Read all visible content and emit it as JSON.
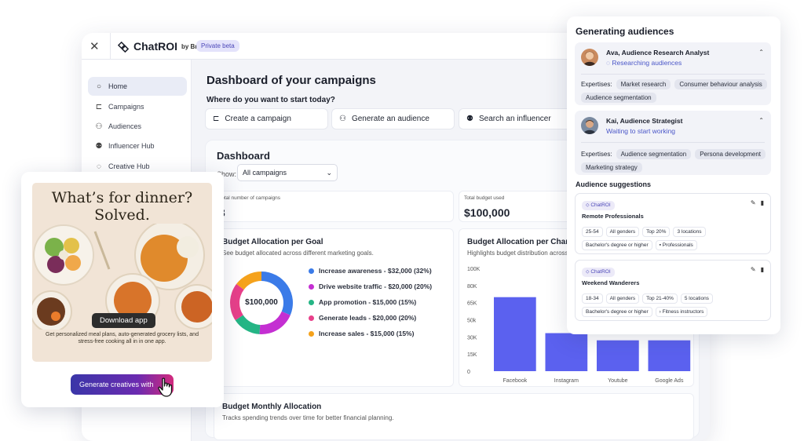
{
  "app": {
    "close_icon": "close-icon",
    "brand": "ChatROI",
    "brand_suffix": "by Bryj",
    "beta_badge": "Private beta"
  },
  "sidebar": {
    "items": [
      {
        "label": "Home",
        "icon": "home-icon"
      },
      {
        "label": "Campaigns",
        "icon": "megaphone-icon"
      },
      {
        "label": "Audiences",
        "icon": "users-icon"
      },
      {
        "label": "Influencer Hub",
        "icon": "influencer-icon"
      },
      {
        "label": "Creative Hub",
        "icon": "creative-icon"
      }
    ]
  },
  "main": {
    "title": "Dashboard of your campaigns",
    "subtitle": "Where do you want to start today?",
    "actions": [
      {
        "label": "Create a campaign",
        "icon": "megaphone-icon"
      },
      {
        "label": "Generate an audience",
        "icon": "users-icon"
      },
      {
        "label": "Search an influencer",
        "icon": "influencer-icon"
      }
    ]
  },
  "dashboard": {
    "title": "Dashboard",
    "show_label": "Show:",
    "filter_value": "All campaigns",
    "stats": [
      {
        "label": "Total number of campaigns",
        "value": "3"
      },
      {
        "label": "Total budget used",
        "value": "$100,000"
      }
    ],
    "goal_card": {
      "title": "Budget Allocation per Goal",
      "subtitle": "See budget allocated across different marketing goals.",
      "center_label": "$100,000"
    },
    "channel_card": {
      "title": "Budget Allocation per Channel",
      "subtitle": "Highlights budget distribution across channels."
    },
    "monthly_card": {
      "title": "Budget Monthly Allocation",
      "subtitle": "Tracks spending trends over time for better financial planning."
    }
  },
  "chart_data": [
    {
      "type": "pie",
      "title": "Budget Allocation per Goal",
      "categories": [
        "Increase awareness - $32,000 (32%)",
        "Drive website traffic - $20,000 (20%)",
        "App promotion - $15,000 (15%)",
        "Generate leads - $20,000 (20%)",
        "Increase sales - $15,000 (15%)"
      ],
      "values": [
        32,
        20,
        15,
        20,
        15
      ],
      "colors": [
        "#3b7be8",
        "#c42fd2",
        "#25b585",
        "#e8408a",
        "#f5a21c"
      ],
      "legend": "right"
    },
    {
      "type": "bar",
      "title": "Budget Allocation per Channel",
      "categories": [
        "Facebook",
        "Instagram",
        "Youtube",
        "Google Ads"
      ],
      "values": [
        72000,
        37000,
        30000,
        30000
      ],
      "yticks": [
        "100K",
        "80K",
        "65K",
        "50k",
        "30K",
        "15K",
        "0"
      ],
      "ylim": [
        0,
        100000
      ],
      "color": "#5b61ef",
      "grid": false
    }
  ],
  "promo": {
    "headline_1": "What’s for dinner?",
    "headline_2": "Solved.",
    "download_label": "Download app",
    "body": "Get personalized meal plans, auto-generated grocery lists, and stress-free cooking all in in one app.",
    "generate_label": "Generate creatives with",
    "cursor_icon": "hand-cursor-icon"
  },
  "panel": {
    "title": "Generating audiences",
    "expertises_label": "Expertises:",
    "agents": [
      {
        "name": "Ava, Audience Research Analyst",
        "status": "Researching audiences",
        "expertises": [
          "Market research",
          "Consumer behaviour analysis",
          "Audience segmentation"
        ]
      },
      {
        "name": "Kai, Audience Strategist",
        "status": "Waiting to start working",
        "expertises": [
          "Audience segmentation",
          "Persona development",
          "Marketing strategy"
        ]
      }
    ],
    "suggestions_title": "Audience suggestions",
    "suggestions": [
      {
        "chip": "ChatROI",
        "name": "Remote Professionals",
        "tags": [
          "25-54",
          "All genders",
          "Top 20%",
          "3 locations",
          "Bachelor's degree or higher",
          "Professionals"
        ]
      },
      {
        "chip": "ChatROI",
        "name": "Weekend Wanderers",
        "tags": [
          "18-34",
          "All genders",
          "Top 21-40%",
          "5 locations",
          "Bachelor's degree or higher",
          "Fitness instructors"
        ]
      }
    ]
  }
}
